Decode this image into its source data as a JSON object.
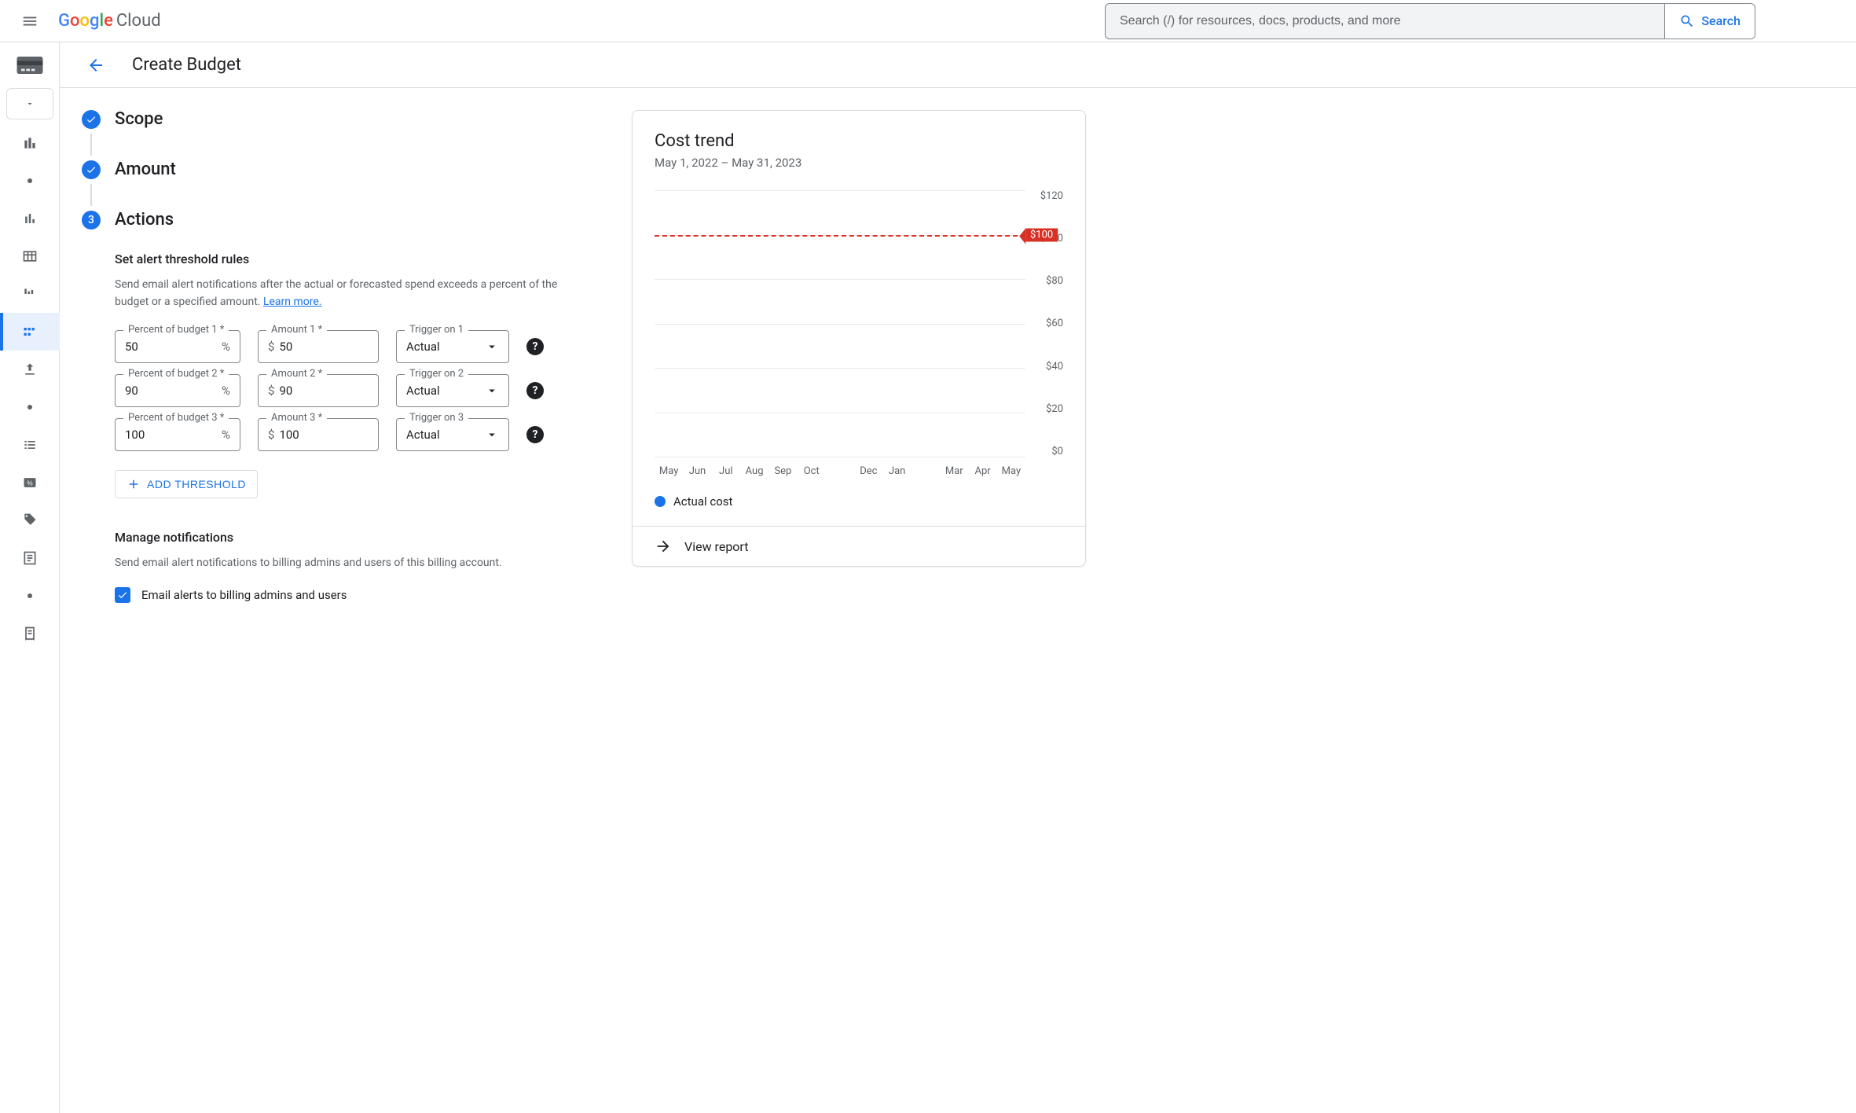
{
  "header": {
    "search_placeholder": "Search (/) for resources, docs, products, and more",
    "search_button": "Search",
    "cloud_label": "Cloud"
  },
  "subheader": {
    "title": "Create Budget"
  },
  "stepper": {
    "scope_label": "Scope",
    "amount_label": "Amount",
    "actions_label": "Actions",
    "actions_number": "3"
  },
  "thresholds": {
    "section_title": "Set alert threshold rules",
    "section_desc": "Send email alert notifications after the actual or forecasted spend exceeds a percent of the budget or a specified amount. ",
    "learn_more": "Learn more.",
    "rows": [
      {
        "percent_label": "Percent of budget 1 *",
        "percent": "50",
        "amount_label": "Amount 1 *",
        "amount": "50",
        "trigger_label": "Trigger on 1",
        "trigger": "Actual"
      },
      {
        "percent_label": "Percent of budget 2 *",
        "percent": "90",
        "amount_label": "Amount 2 *",
        "amount": "90",
        "trigger_label": "Trigger on 2",
        "trigger": "Actual"
      },
      {
        "percent_label": "Percent of budget 3 *",
        "percent": "100",
        "amount_label": "Amount 3 *",
        "amount": "100",
        "trigger_label": "Trigger on 3",
        "trigger": "Actual"
      }
    ],
    "add_label": "ADD THRESHOLD",
    "currency": "$",
    "percent_sign": "%"
  },
  "notifications": {
    "title": "Manage notifications",
    "desc": "Send email alert notifications to billing admins and users of this billing account.",
    "checkbox_label": "Email alerts to billing admins and users"
  },
  "card": {
    "title": "Cost trend",
    "subtitle": "May 1, 2022 – May 31, 2023",
    "legend_label": "Actual cost",
    "footer_label": "View report"
  },
  "chart_data": {
    "type": "bar",
    "title": "Cost trend",
    "xlabel": "",
    "ylabel": "",
    "ylim": [
      0,
      120
    ],
    "budget_line": 100,
    "budget_line_label": "$100",
    "y_ticks": [
      "$120",
      "$100",
      "$80",
      "$60",
      "$40",
      "$20",
      "$0"
    ],
    "categories": [
      "May",
      "Jun",
      "Jul",
      "Aug",
      "Sep",
      "Oct",
      "",
      "Dec",
      "Jan",
      "",
      "Mar",
      "Apr",
      "May"
    ],
    "series": [
      {
        "name": "Actual cost",
        "values": [
          0,
          0,
          0,
          0,
          0,
          0,
          0,
          0,
          0,
          0,
          0,
          0,
          0
        ]
      }
    ]
  }
}
